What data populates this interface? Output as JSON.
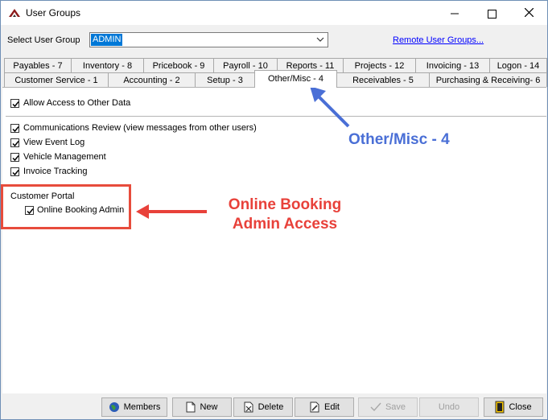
{
  "window": {
    "title": "User Groups"
  },
  "header": {
    "select_label": "Select User Group",
    "selected_group": "ADMIN",
    "remote_link": "Remote User Groups..."
  },
  "tabs_top": [
    {
      "label": "Payables - 7"
    },
    {
      "label": "Inventory - 8"
    },
    {
      "label": "Pricebook - 9"
    },
    {
      "label": "Payroll - 10"
    },
    {
      "label": "Reports - 11"
    },
    {
      "label": "Projects - 12"
    },
    {
      "label": "Invoicing - 13"
    },
    {
      "label": "Logon - 14"
    }
  ],
  "tabs_bottom": [
    {
      "label": "Customer Service - 1"
    },
    {
      "label": "Accounting - 2"
    },
    {
      "label": "Setup - 3"
    },
    {
      "label": "Other/Misc - 4",
      "active": true
    },
    {
      "label": "Receivables - 5"
    },
    {
      "label": "Purchasing & Receiving- 6"
    }
  ],
  "permissions": {
    "allow_access": {
      "label": "Allow Access to Other Data",
      "checked": true
    },
    "comm_review": {
      "label": "Communications Review (view messages from other users)",
      "checked": true
    },
    "event_log": {
      "label": "View Event Log",
      "checked": true
    },
    "vehicle_mgmt": {
      "label": "Vehicle Management",
      "checked": true
    },
    "invoice_tracking": {
      "label": "Invoice Tracking",
      "checked": true
    }
  },
  "customer_portal": {
    "group_label": "Customer Portal",
    "online_booking_admin": {
      "label": "Online Booking Admin",
      "checked": true
    }
  },
  "annotations": {
    "tab_callout": "Other/Misc - 4",
    "booking_callout_line1": "Online Booking",
    "booking_callout_line2": "Admin Access",
    "red_color": "#e8413a",
    "blue_color": "#4a6fd6"
  },
  "footer": {
    "members": "Members",
    "new": "New",
    "delete": "Delete",
    "edit": "Edit",
    "save": "Save",
    "undo": "Undo",
    "close": "Close"
  }
}
